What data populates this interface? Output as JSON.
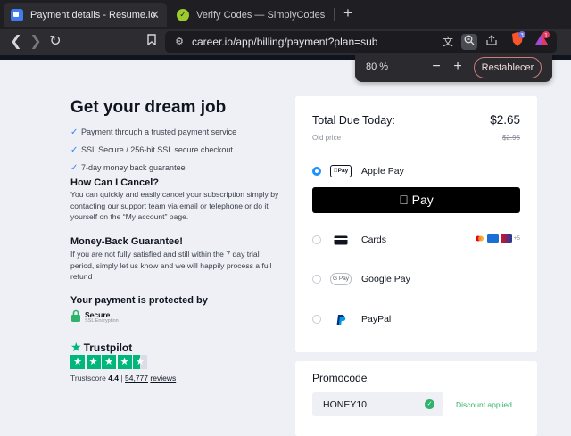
{
  "tabs": [
    {
      "title": "Payment details - Resume.io",
      "active": true
    },
    {
      "title": "Verify Codes — SimplyCodes",
      "active": false
    }
  ],
  "toolbar": {
    "url": "career.io/app/billing/payment?plan=sub",
    "brave_badge": "3",
    "rewards_badge": "1"
  },
  "zoom": {
    "level": "80 %",
    "reset_label": "Restablecer"
  },
  "left": {
    "title": "Get your dream job",
    "checks": [
      "Payment through a trusted payment service",
      "SSL Secure / 256-bit SSL secure checkout",
      "7-day money back guarantee"
    ],
    "cancel_title": "How Can I Cancel?",
    "cancel_text": "You can quickly and easily cancel your subscription simply by contacting our support team via email or telephone or do it yourself on the “My account” page.",
    "money_title": "Money-Back Guarantee!",
    "money_text": "If you are not fully satisfied and still within the 7 day trial period, simply let us know and we will happily process a full refund",
    "protected_title": "Your payment is protected by",
    "secure_title": "Secure",
    "secure_sub": "SSL Encryption",
    "trustpilot": {
      "name": "Trustpilot",
      "rating": 4.5,
      "score_label": "Trustscore",
      "score": "4.4",
      "sep": "|",
      "reviews_count": "54,777",
      "reviews_label": "reviews"
    }
  },
  "summary": {
    "total_label": "Total Due Today:",
    "total_value": "$2.65",
    "old_label": "Old price",
    "old_value": "$2.95"
  },
  "payment_methods": [
    {
      "label": "Apple Pay",
      "selected": true,
      "icon": "apple-pay-icon",
      "badge": "Pay"
    },
    {
      "label": "Cards",
      "selected": false,
      "icon": "card-icon"
    },
    {
      "label": "Google Pay",
      "selected": false,
      "icon": "google-pay-icon",
      "badge": "G Pay"
    },
    {
      "label": "PayPal",
      "selected": false,
      "icon": "paypal-icon"
    }
  ],
  "applepay_button": " Pay",
  "cards_more": "+5",
  "promo": {
    "label": "Promocode",
    "code": "HONEY10",
    "status": "Discount applied"
  },
  "colors": {
    "accent": "#1a91ff",
    "success": "#2fb36b",
    "trustpilot": "#00b67a"
  }
}
